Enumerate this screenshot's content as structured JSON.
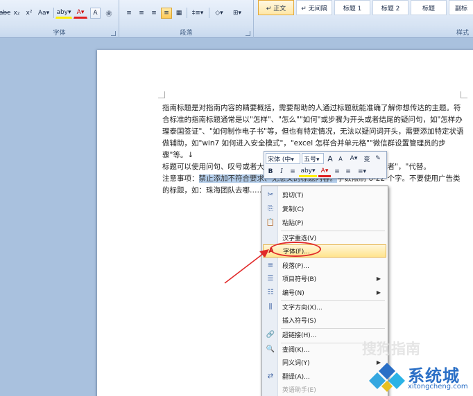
{
  "ribbon": {
    "font_group": {
      "label": "字体",
      "buttons": [
        "abc",
        "x₂",
        "x²",
        "Aa▾",
        "aby▾",
        "A▾",
        "A",
        "㊎"
      ]
    },
    "paragraph_group": {
      "label": "段落",
      "buttons": [
        "≡",
        "≡",
        "≡",
        "≡",
        "▦",
        "‡≡▾",
        "◇▾",
        "⊞▾"
      ]
    },
    "styles_group": {
      "label": "样式",
      "items": [
        "↵ 正文",
        "↵ 无间隔",
        "标题 1",
        "标题 2",
        "标题",
        "副标"
      ]
    }
  },
  "document": {
    "paragraphs": [
      {
        "text": "指南标题是对指南内容的精要概括，需要帮助的人通过标题就能准确了解你想传达的主题。符合标准的指南标题通常是以\"怎样\"、\"怎么\"\"如何\"或步骤为开头或者结尾的疑问句，如\"怎样办理泰国签证\"、\"如何制作电子书\"等，但也有特定情况，无法以疑问词开头，需要添加特定状语做辅助，如\"win7 如何进入安全模式\"，\"excel 怎样合并单元格\"\"微信群设置管理员的步骤\"等。↓"
      },
      {
        "text": "标题可以使用问句、叹号或者大……，如需要间隔，请用空格、\"：\"或者\"，\"代替。"
      },
      {
        "prefix": "注意事项：",
        "selected": "禁止添加不符合要求、无意义的标题内容。",
        "suffix": "字数限制 6-22 个字。不要使用广告类的标题，如：珠海团队去哪……"
      }
    ]
  },
  "mini_toolbar": {
    "font_name": "宋体 (中▾",
    "font_size": "五号▾",
    "row1": [
      "A",
      "A",
      "A▾",
      "变",
      "✎"
    ],
    "row2": [
      "B",
      "I",
      "≡",
      "aby▾",
      "A▾",
      "≡",
      "≡",
      "≡▾"
    ]
  },
  "context_menu": {
    "items": [
      {
        "icon": "✂",
        "label": "剪切(T)"
      },
      {
        "icon": "⎘",
        "label": "复制(C)"
      },
      {
        "icon": "📋",
        "label": "粘贴(P)"
      },
      {
        "icon": "",
        "label": "汉字重选(V)"
      },
      {
        "icon": "A",
        "label": "字体(F)..."
      },
      {
        "icon": "≡",
        "label": "段落(P)..."
      },
      {
        "icon": "☰",
        "label": "项目符号(B)"
      },
      {
        "icon": "☷",
        "label": "编号(N)"
      },
      {
        "icon": "⫼",
        "label": "文字方向(X)..."
      },
      {
        "icon": "",
        "label": "插入符号(S)"
      },
      {
        "icon": "🔗",
        "label": "超链接(H)..."
      },
      {
        "icon": "🔍",
        "label": "查阅(K)..."
      },
      {
        "icon": "",
        "label": "同义词(Y)"
      },
      {
        "icon": "⇄",
        "label": "翻译(A)..."
      },
      {
        "icon": "",
        "label": "英语助手(E)"
      }
    ]
  },
  "watermark": {
    "ghost_text": "搜狗指南",
    "brand_name": "系统城",
    "url": "xitongcheng.com"
  },
  "colors": {
    "highlight_red": "#e12a2a",
    "selection": "#b3cdea",
    "brand_blue": "#2a6fc6"
  }
}
